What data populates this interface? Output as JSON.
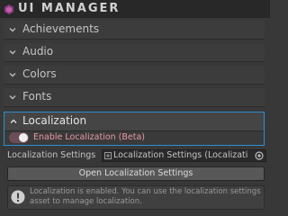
{
  "window": {
    "title": "UI MANAGER"
  },
  "sections": [
    {
      "label": "Achievements",
      "expanded": false
    },
    {
      "label": "Audio",
      "expanded": false
    },
    {
      "label": "Colors",
      "expanded": false
    },
    {
      "label": "Fonts",
      "expanded": false
    }
  ],
  "localization": {
    "label": "Localization",
    "expanded": true,
    "enable_toggle": {
      "label": "Enable Localization (Beta)",
      "on": true
    },
    "settings_field": {
      "label": "Localization Settings",
      "value": "Localization Settings (Localization Se"
    },
    "open_button_label": "Open Localization Settings",
    "info_message": "Localization is enabled. You can use the localization settings asset to manage localization."
  },
  "colors": {
    "accent": "#2f8dd5",
    "toggle_label": "#ea9aa8",
    "toggle_track": "#6e4c57",
    "logo": "#8b3d86"
  },
  "icons": {
    "logo": "ui-manager-logo-icon",
    "collapsed": "chevron-down-icon",
    "expanded": "chevron-up-icon",
    "asset": "scriptable-object-icon",
    "picker": "object-picker-icon",
    "info": "info-icon"
  }
}
